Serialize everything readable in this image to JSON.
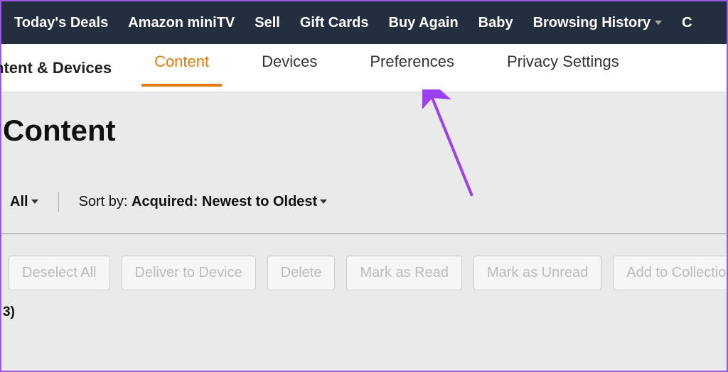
{
  "top_nav": {
    "items": [
      "Today's Deals",
      "Amazon miniTV",
      "Sell",
      "Gift Cards",
      "Buy Again",
      "Baby",
      "Browsing History"
    ],
    "truncated_last": "C"
  },
  "sub_nav": {
    "breadcrumb": "ntent & Devices",
    "tabs": [
      {
        "label": "Content",
        "active": true
      },
      {
        "label": "Devices",
        "active": false
      },
      {
        "label": "Preferences",
        "active": false
      },
      {
        "label": "Privacy Settings",
        "active": false
      }
    ]
  },
  "page": {
    "title": "Content",
    "filter_all": "All",
    "sort_prefix": "Sort by: ",
    "sort_value": "Acquired: Newest to Oldest",
    "actions": [
      "Deselect All",
      "Deliver to Device",
      "Delete",
      "Mark as Read",
      "Mark as Unread",
      "Add to Collection"
    ],
    "count_fragment": "3)"
  }
}
